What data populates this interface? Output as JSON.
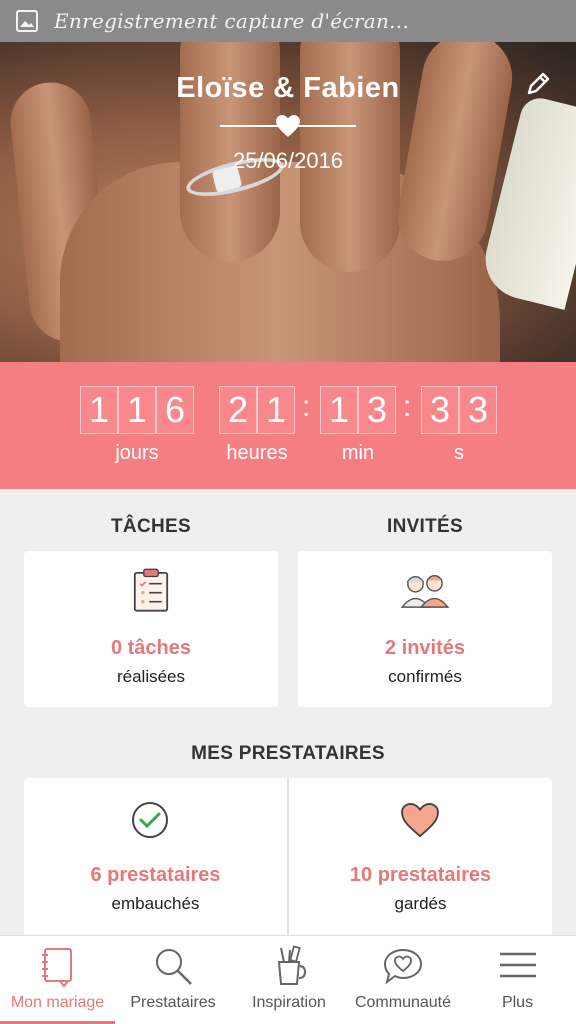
{
  "status_bar": {
    "text": "Enregistrement capture d'écran..."
  },
  "header": {
    "couple_names": "Eloïse & Fabien",
    "wedding_date": "25/06/2016"
  },
  "countdown": {
    "days_digits": [
      "1",
      "1",
      "6"
    ],
    "hours_digits": [
      "2",
      "1"
    ],
    "minutes_digits": [
      "1",
      "3"
    ],
    "seconds_digits": [
      "3",
      "3"
    ],
    "separator": ":",
    "labels": {
      "days": "jours",
      "hours": "heures",
      "minutes": "min",
      "seconds": "s"
    }
  },
  "tasks": {
    "title": "TÂCHES",
    "value": "0 tâches",
    "sub": "réalisées"
  },
  "guests": {
    "title": "INVITÉS",
    "value": "2 invités",
    "sub": "confirmés"
  },
  "vendors": {
    "title": "MES PRESTATAIRES",
    "hired": {
      "value": "6 prestataires",
      "sub": "embauchés"
    },
    "saved": {
      "value": "10 prestataires",
      "sub": "gardés"
    }
  },
  "nav": {
    "items": [
      {
        "label": "Mon mariage",
        "icon": "notebook-icon",
        "active": true
      },
      {
        "label": "Prestataires",
        "icon": "search-icon",
        "active": false
      },
      {
        "label": "Inspiration",
        "icon": "inspiration-cup-icon",
        "active": false
      },
      {
        "label": "Communauté",
        "icon": "chat-heart-icon",
        "active": false
      },
      {
        "label": "Plus",
        "icon": "menu-icon",
        "active": false
      }
    ]
  },
  "colors": {
    "accent": "#f57e82",
    "accent_text": "#e5787a",
    "check_green": "#3aa64c",
    "heart_peach": "#f6a68c"
  }
}
